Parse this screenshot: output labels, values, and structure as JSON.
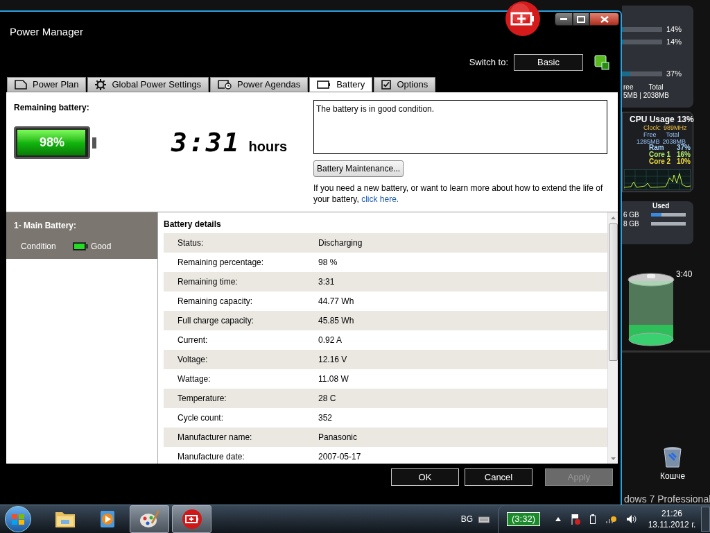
{
  "window": {
    "title": "Power Manager",
    "switch_label": "Switch to:",
    "switch_button": "Basic"
  },
  "tabs": [
    {
      "label": "Power Plan",
      "selected": false
    },
    {
      "label": "Global Power Settings",
      "selected": false
    },
    {
      "label": "Power Agendas",
      "selected": false
    },
    {
      "label": "Battery",
      "selected": true
    },
    {
      "label": "Options",
      "selected": false
    }
  ],
  "remaining": {
    "label": "Remaining battery:",
    "level": 0.98,
    "percent": "98%",
    "time": "3:31",
    "unit": "hours"
  },
  "message": "The battery is in good condition.",
  "maintenance_button": "Battery Maintenance...",
  "hint": "If you need a new battery, or want to learn more about how to extend the life of your battery,",
  "hint_link": "click here.",
  "batteries": [
    {
      "name": "1- Main Battery:",
      "condition_label": "Condition",
      "condition": "Good",
      "selected": true
    }
  ],
  "details": {
    "title": "Battery details",
    "rows": [
      {
        "label": "Status:",
        "value": "Discharging"
      },
      {
        "label": "Remaining percentage:",
        "value": "98 %"
      },
      {
        "label": "Remaining time:",
        "value": "3:31"
      },
      {
        "label": "Remaining capacity:",
        "value": "44.77 Wh"
      },
      {
        "label": "Full charge capacity:",
        "value": "45.85 Wh"
      },
      {
        "label": "Current:",
        "value": "0.92 A"
      },
      {
        "label": "Voltage:",
        "value": "12.16 V"
      },
      {
        "label": "Wattage:",
        "value": "11.08 W"
      },
      {
        "label": "Temperature:",
        "value": "28 C"
      },
      {
        "label": "Cycle count:",
        "value": "352"
      },
      {
        "label": "Manufacturer name:",
        "value": "Panasonic"
      },
      {
        "label": "Manufacture date:",
        "value": "2007-05-17"
      }
    ]
  },
  "buttons": [
    {
      "label": "OK",
      "disabled": false
    },
    {
      "label": "Cancel",
      "disabled": false
    },
    {
      "label": "Apply",
      "disabled": true
    }
  ],
  "desktop": {
    "meter_gadget": {
      "rows": [
        {
          "value": "14%",
          "level": 0.05
        },
        {
          "value": "14%",
          "level": 0.05
        },
        {
          "value": "37%",
          "level": 0.2
        }
      ],
      "free_label": "ree",
      "total_label": "Total",
      "memory": "5MB | 2038MB"
    },
    "cpu_gadget": {
      "title": "CPU Usage",
      "usage": "13%",
      "clock_label": "Clock:",
      "clock": "989MHz",
      "free_label": "Free",
      "total_label": "Total",
      "free": "1285MB",
      "total": "2038MB",
      "rows": [
        {
          "label": "Ram",
          "value": "37%",
          "color": "#a8d8ff"
        },
        {
          "label": "Core 1",
          "value": "16%",
          "color": "#b6f06a"
        },
        {
          "label": "Core 2",
          "value": "10%",
          "color": "#f0e040"
        }
      ]
    },
    "drive_gadget": {
      "used_label": "Used",
      "rows": [
        {
          "size": "6 GB",
          "level": 0.3
        },
        {
          "size": "8 GB"
        }
      ]
    },
    "battery_gadget": {
      "time": "3:40",
      "level": 0.25
    },
    "recycle_bin": "Кошче",
    "brand": "dows 7 Professional"
  },
  "taskbar": {
    "apps": [
      {
        "selected": false
      },
      {
        "selected": false
      },
      {
        "selected": true
      },
      {
        "selected": true
      }
    ],
    "language": "BG",
    "battery_time": "(3:32)",
    "time": "21:26",
    "date": "13.11.2012 г."
  }
}
